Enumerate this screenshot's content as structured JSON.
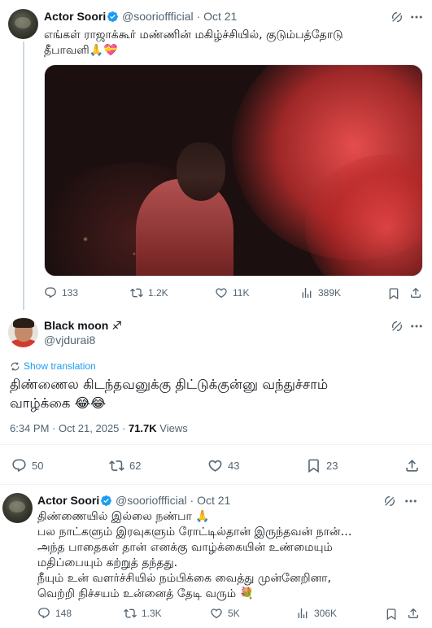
{
  "tweet1": {
    "name": "Actor Soori",
    "handle": "@soorioffficial",
    "time": "Oct 21",
    "text": "எங்கள் ராஜாக்கூர் மண்ணின் மகிழ்ச்சியில், குடும்பத்தோடு\nதீபாவளி🙏💝",
    "stats": {
      "replies": "133",
      "reposts": "1.2K",
      "likes": "11K",
      "views": "389K"
    }
  },
  "main_tweet": {
    "name": "Black moon ♐",
    "handle": "@vjdurai8",
    "show_translation": "Show translation",
    "text": "திண்ணைல கிடந்தவனுக்கு திட்டுக்குன்னு வந்துச்சாம்\nவாழ்க்கை 😂😂",
    "timestamp": "6:34 PM · Oct 21, 2025 · ",
    "views_count": "71.7K",
    "views_label": " Views",
    "stats": {
      "replies": "50",
      "reposts": "62",
      "likes": "43",
      "bookmarks": "23"
    }
  },
  "reply": {
    "name": "Actor Soori",
    "handle": "@soorioffficial",
    "time": "Oct 21",
    "text": "திண்ணையில் இல்லை நண்பா 🙏\nபல நாட்களும் இரவுகளும் ரோட்டில்தான் இருந்தவன் நான்…\nஅந்த பாதைகள் தான் எனக்கு வாழ்க்கையின் உண்மையும்\nமதிப்பையும் கற்றுத் தந்தது.\nநீயும் உன் வளர்ச்சியில் நம்பிக்கை வைத்து முன்னேறினா,\nவெற்றி நிச்சயம் உன்னைத் தேடி வரும் 💐",
    "stats": {
      "replies": "148",
      "reposts": "1.3K",
      "likes": "5K",
      "views": "306K"
    }
  },
  "icons": {
    "reply": "reply-icon",
    "repost": "repost-icon",
    "like": "heart-icon",
    "views": "views-icon",
    "bookmark": "bookmark-icon",
    "share": "share-icon",
    "grok": "grok-icon",
    "more": "more-icon",
    "verified": "verified-badge-icon"
  },
  "colors": {
    "accent": "#1d9bf0",
    "muted": "#536471",
    "text": "#0f1419"
  }
}
